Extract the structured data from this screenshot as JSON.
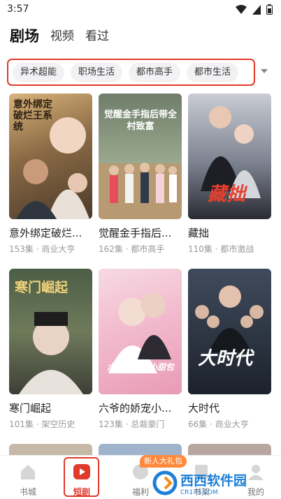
{
  "status_bar": {
    "time": "3:57",
    "icons": [
      "wifi-icon",
      "sim-icon",
      "battery-icon"
    ]
  },
  "top_tabs": [
    {
      "label": "剧场",
      "active": true
    },
    {
      "label": "视频",
      "active": false
    },
    {
      "label": "看过",
      "active": false
    }
  ],
  "filters": [
    "异术超能",
    "职场生活",
    "都市高手",
    "都市生活"
  ],
  "dramas": [
    {
      "title": "意外绑定破烂...",
      "meta": "153集 · 商业大亨",
      "poster_text": "意外绑定破烂王系统"
    },
    {
      "title": "觉醒金手指后...",
      "meta": "162集 · 都市高手",
      "poster_text": "觉醒金手指后带全村致富"
    },
    {
      "title": "藏拙",
      "meta": "110集 · 都市激战",
      "poster_text": "藏拙"
    },
    {
      "title": "寒门崛起",
      "meta": "101集 · 架空历史",
      "poster_text": "寒门崛起"
    },
    {
      "title": "六爷的娇宠小...",
      "meta": "123集 · 总裁豪门",
      "poster_text": "六爷的娇宠小甜包"
    },
    {
      "title": "大时代",
      "meta": "66集 · 商业大亨",
      "poster_text": "大时代"
    }
  ],
  "bottom_nav": [
    {
      "label": "书城",
      "icon": "home-icon",
      "active": false
    },
    {
      "label": "短剧",
      "icon": "play-icon",
      "active": true
    },
    {
      "label": "福利",
      "icon": "gift-icon",
      "active": false
    },
    {
      "label": "书架",
      "icon": "book-icon",
      "active": false
    },
    {
      "label": "我的",
      "icon": "user-icon",
      "active": false
    }
  ],
  "gift_badge": "新人大礼包",
  "watermark": {
    "text": "西西软件园",
    "sub": "CR173.COM"
  },
  "colors": {
    "accent": "#e03a2b",
    "chip_bg": "#f2f2f4",
    "meta": "#999999"
  }
}
